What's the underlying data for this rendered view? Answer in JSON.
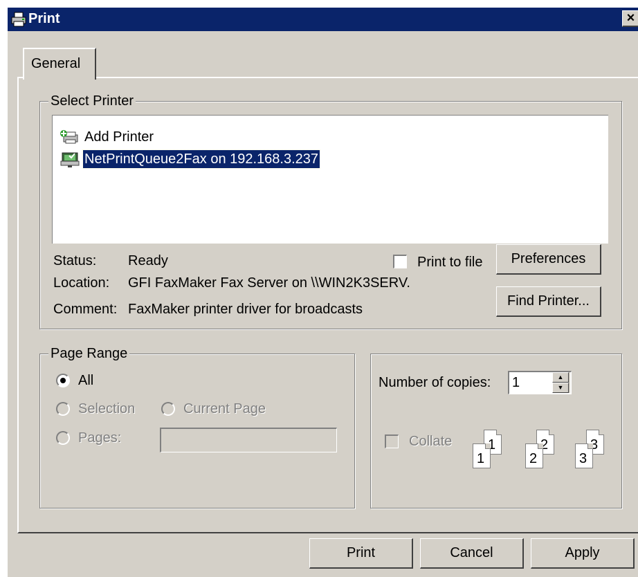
{
  "window": {
    "title": "Print",
    "close_glyph": "×"
  },
  "tabs": [
    {
      "label": "General"
    }
  ],
  "select_printer": {
    "legend": "Select Printer",
    "items": [
      {
        "label": "Add Printer",
        "icon": "add-printer-icon"
      },
      {
        "label": "NetPrintQueue2Fax on 192.168.3.237",
        "icon": "network-printer-icon",
        "selected": true
      }
    ],
    "status_label": "Status:",
    "status_value": "Ready",
    "location_label": "Location:",
    "location_value": "GFI FaxMaker Fax Server on \\\\WIN2K3SERV.",
    "comment_label": "Comment:",
    "comment_value": "FaxMaker printer driver for broadcasts",
    "print_to_file_label": "Print to file",
    "print_to_file_checked": false,
    "preferences_label": "Preferences",
    "find_printer_label": "Find Printer..."
  },
  "page_range": {
    "legend": "Page Range",
    "all_label": "All",
    "selection_label": "Selection",
    "current_page_label": "Current Page",
    "pages_label": "Pages:",
    "pages_value": "",
    "selected": "All"
  },
  "copies": {
    "label": "Number of copies:",
    "value": "1",
    "collate_label": "Collate",
    "collate_checked": false,
    "collate_icon": "collate-pages-icon",
    "pages": [
      "1",
      "1",
      "2",
      "2",
      "3",
      "3"
    ]
  },
  "buttons": {
    "print": "Print",
    "cancel": "Cancel",
    "apply": "Apply"
  },
  "colors": {
    "titlebar": "#0a246a",
    "face": "#d4d0c8",
    "selection": "#0a246a"
  }
}
